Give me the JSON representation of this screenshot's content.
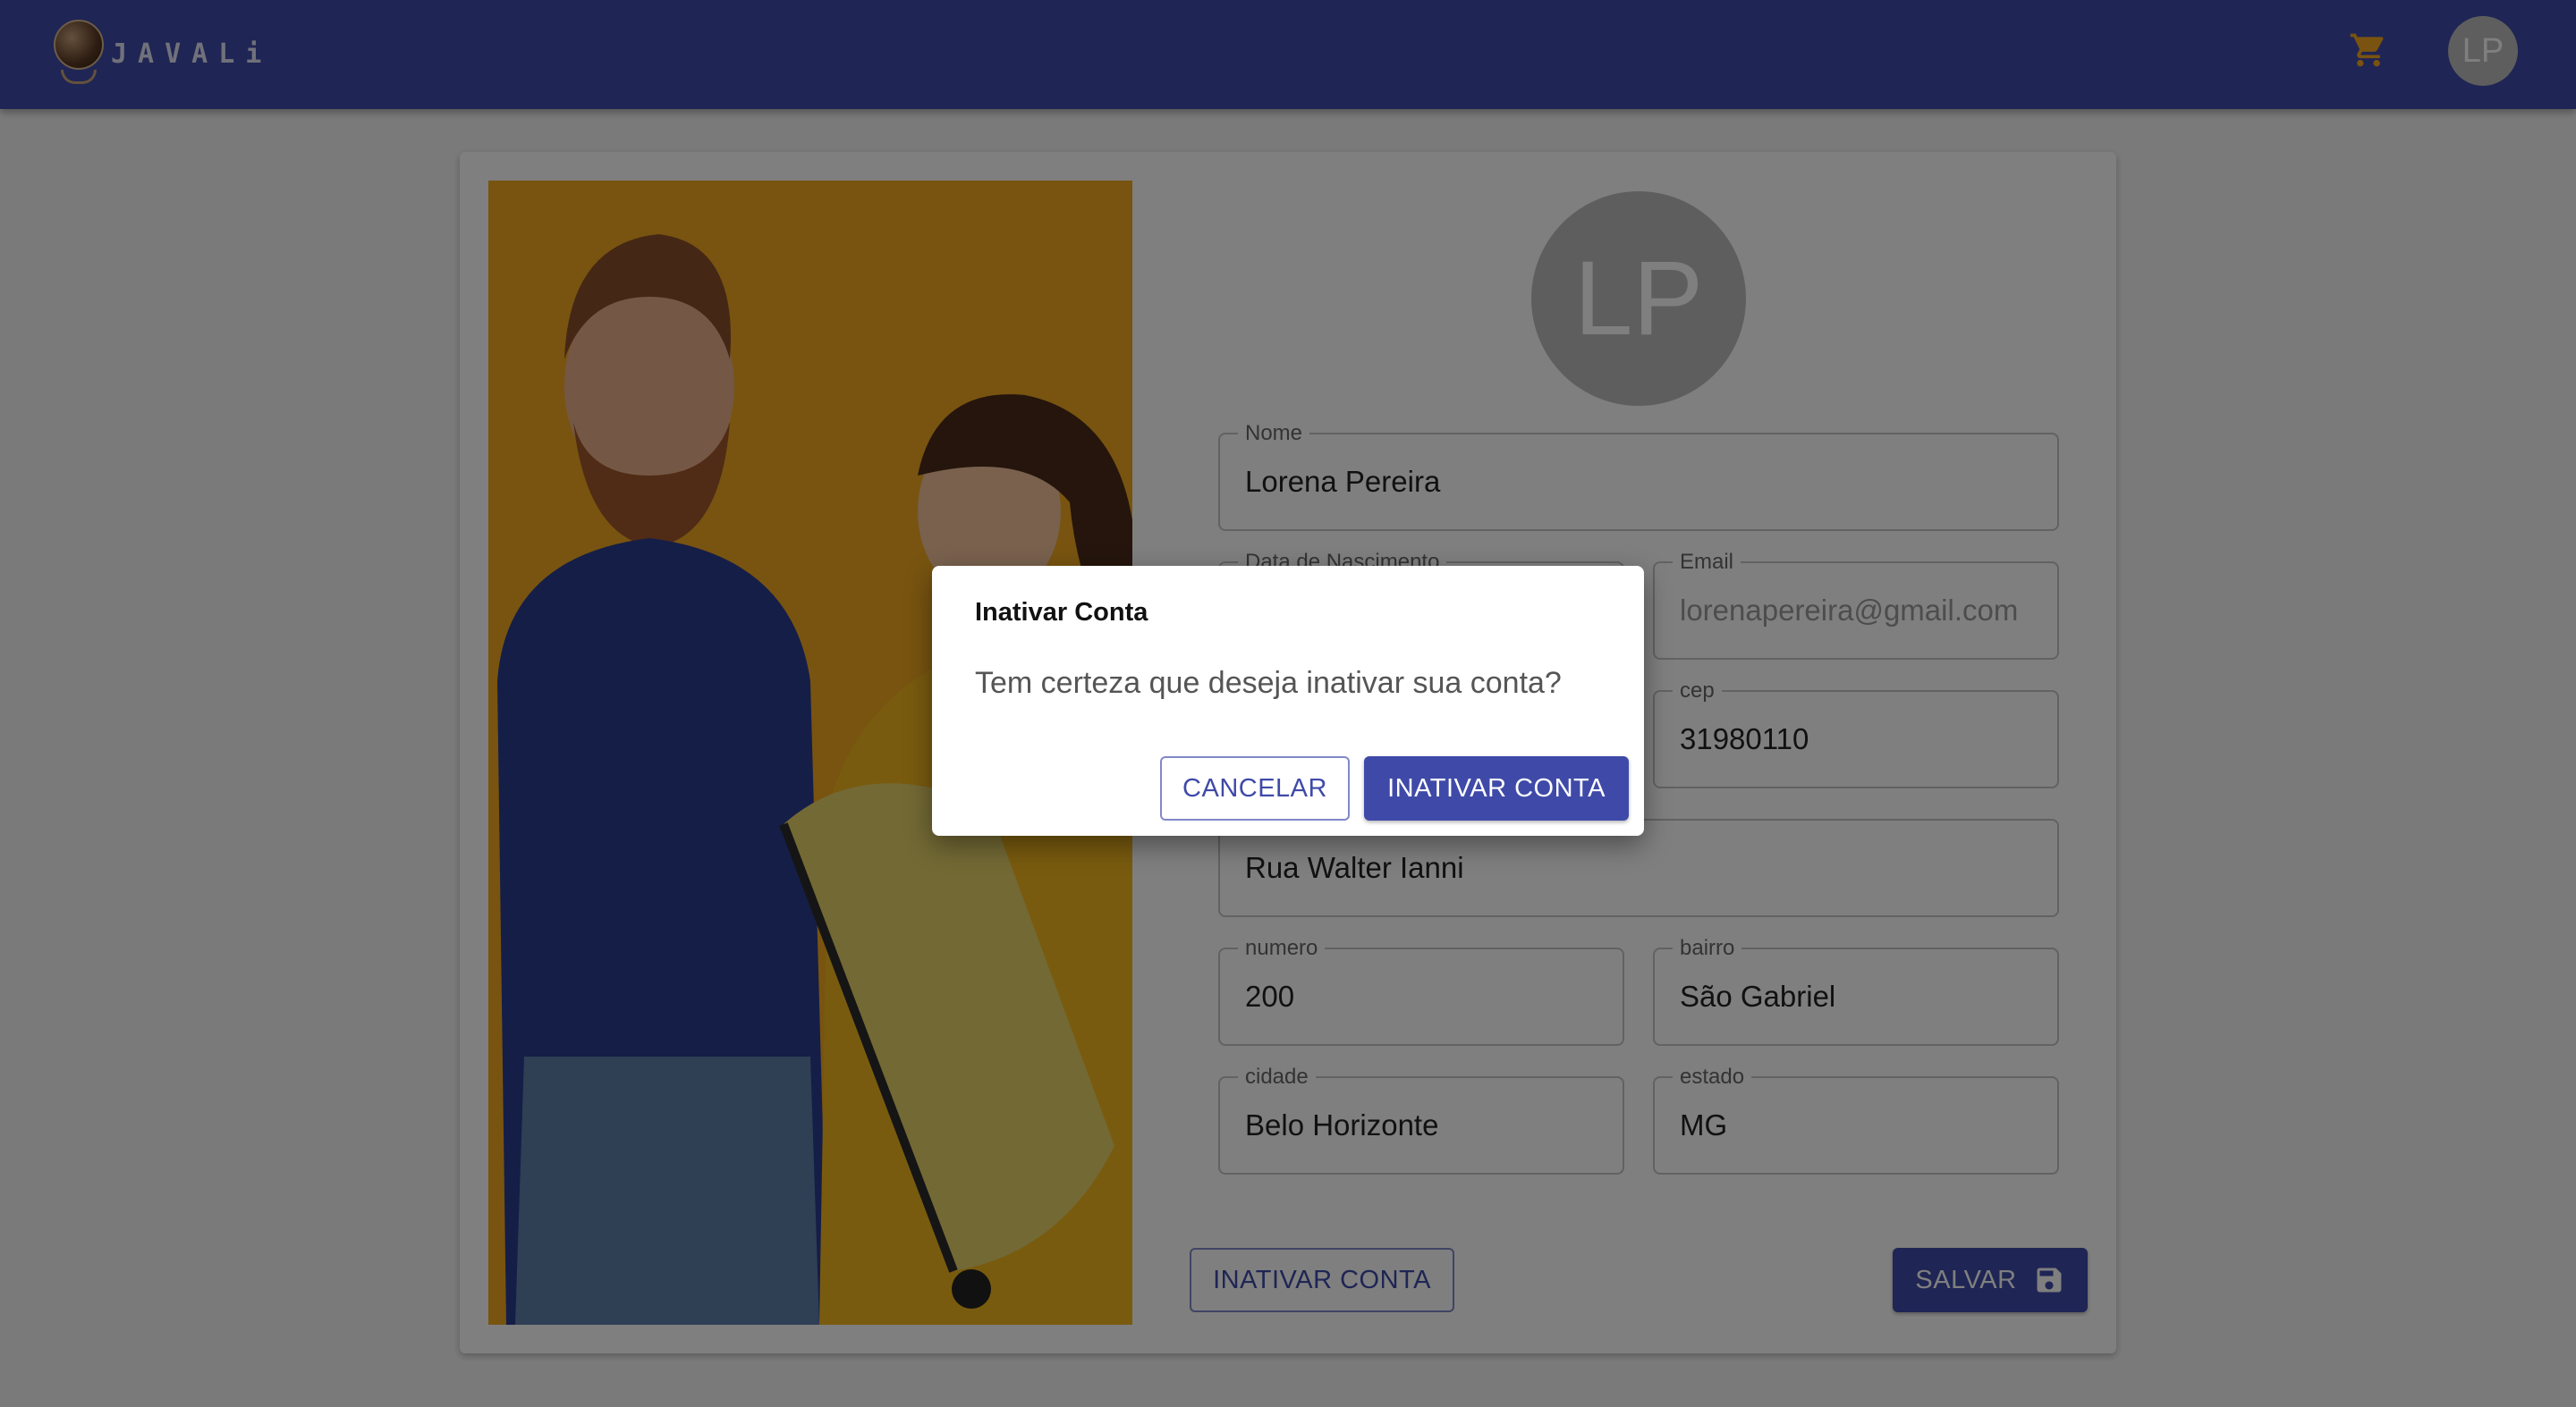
{
  "app": {
    "name": "JAVALi"
  },
  "header": {
    "cart_icon": "shopping-cart-icon",
    "avatar_initials": "LP"
  },
  "profile": {
    "avatar_initials": "LP",
    "fields": {
      "nome": {
        "label": "Nome",
        "value": "Lorena Pereira"
      },
      "nascimento": {
        "label": "Data de Nascimento",
        "value": ""
      },
      "email": {
        "label": "Email",
        "value": "lorenapereira@gmail.com"
      },
      "cep": {
        "label": "cep",
        "value": "31980110"
      },
      "rua": {
        "label": "",
        "value": "Rua Walter Ianni"
      },
      "numero": {
        "label": "numero",
        "value": "200"
      },
      "bairro": {
        "label": "bairro",
        "value": "São Gabriel"
      },
      "cidade": {
        "label": "cidade",
        "value": "Belo Horizonte"
      },
      "estado": {
        "label": "estado",
        "value": "MG"
      }
    },
    "deactivate_label": "INATIVAR CONTA",
    "save_label": "SALVAR",
    "save_icon": "floppy-disk-icon"
  },
  "dialog": {
    "title": "Inativar Conta",
    "message": "Tem certeza que deseja inativar sua conta?",
    "cancel_label": "CANCELAR",
    "confirm_label": "INATIVAR CONTA"
  },
  "colors": {
    "primary": "#3f4aa8",
    "cart": "#f5a623",
    "photo_background": "#f0a820"
  }
}
